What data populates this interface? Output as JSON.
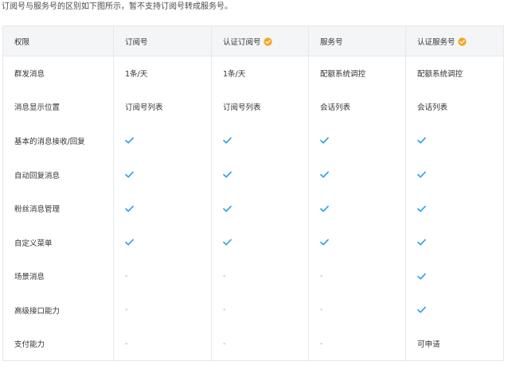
{
  "intro_text": "订阅号与服务号的区别如下图所示，暂不支持订阅号转成服务号。",
  "colors": {
    "check": "#2fa3e6",
    "verified_badge": "#f5a623",
    "header_bg": "#f4f5f7",
    "border": "#e6e8eb"
  },
  "table": {
    "headers": [
      {
        "label": "权限",
        "verified": false
      },
      {
        "label": "订阅号",
        "verified": false
      },
      {
        "label": "认证订阅号",
        "verified": true
      },
      {
        "label": "服务号",
        "verified": false
      },
      {
        "label": "认证服务号",
        "verified": true
      }
    ],
    "rows": [
      {
        "feature": "群发消息",
        "cells": [
          "1条/天",
          "1条/天",
          "配额系统调控",
          "配额系统调控"
        ]
      },
      {
        "feature": "消息显示位置",
        "cells": [
          "订阅号列表",
          "订阅号列表",
          "会话列表",
          "会话列表"
        ]
      },
      {
        "feature": "基本的消息接收/回复",
        "cells": [
          "check",
          "check",
          "check",
          "check"
        ]
      },
      {
        "feature": "自动回复消息",
        "cells": [
          "check",
          "check",
          "check",
          "check"
        ]
      },
      {
        "feature": "粉丝消息管理",
        "cells": [
          "check",
          "check",
          "check",
          "check"
        ]
      },
      {
        "feature": "自定义菜单",
        "cells": [
          "check",
          "check",
          "check",
          "check"
        ]
      },
      {
        "feature": "场景消息",
        "cells": [
          "-",
          "-",
          "-",
          "check"
        ]
      },
      {
        "feature": "高级接口能力",
        "cells": [
          "-",
          "-",
          "-",
          "check"
        ]
      },
      {
        "feature": "支付能力",
        "cells": [
          "-",
          "-",
          "-",
          "可申请"
        ]
      }
    ]
  }
}
